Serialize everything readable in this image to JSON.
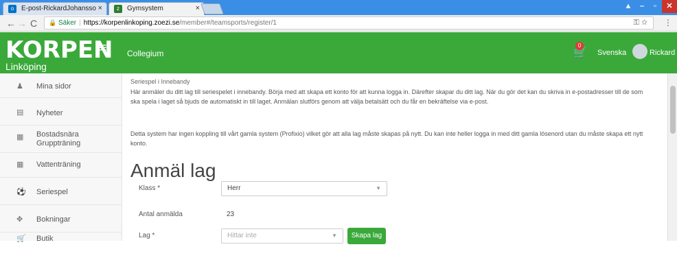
{
  "browser": {
    "tabs": [
      {
        "label": "E-post-RickardJohansso",
        "close": "×"
      },
      {
        "label": "Gymsystem",
        "close": "×"
      }
    ],
    "secure_label": "Säker",
    "url_host": "https://korpenlinkoping.zoezi.se",
    "url_path": "/member#/teamsports/register/1"
  },
  "header": {
    "logo_main": "KORPEN",
    "logo_sub": "Linköping",
    "org": "Collegium",
    "cart_badge": "0",
    "language": "Svenska",
    "user": "Rickard"
  },
  "sidebar": {
    "items": [
      {
        "label": "Mina sidor",
        "icon": "person-icon"
      },
      {
        "label": "Nyheter",
        "icon": "newspaper-icon"
      },
      {
        "label": "Bostadsnära Gruppträning",
        "icon": "calendar-icon"
      },
      {
        "label": "Vattenträning",
        "icon": "calendar-icon"
      },
      {
        "label": "Seriespel",
        "icon": "ball-icon"
      },
      {
        "label": "Bokningar",
        "icon": "pin-icon"
      },
      {
        "label": "Butik",
        "icon": "cart-icon"
      }
    ]
  },
  "main": {
    "subtitle": "Seriespel i Innebandy",
    "para1": "Här anmäler du ditt lag till seriespelet i innebandy. Börja med att skapa ett konto för att kunna logga in. Därefter skapar du ditt lag. När du gör det kan du skriva in e-postadresser till de som ska spela i laget så bjuds de automatiskt in till laget. Anmälan slutförs genom att välja betalsätt och du får en bekräftelse via e-post.",
    "para2": "Detta system har ingen koppling till vårt gamla system (Profixio) vilket gör att alla lag måste skapas på nytt. Du kan inte heller logga in med ditt gamla lösenord utan du måste skapa ett nytt konto.",
    "title": "Anmäl lag",
    "form": {
      "class_label": "Klass *",
      "class_value": "Herr",
      "count_label": "Antal anmälda",
      "count_value": "23",
      "team_label": "Lag *",
      "team_placeholder": "Hittar inte",
      "create_button": "Skapa lag"
    }
  }
}
